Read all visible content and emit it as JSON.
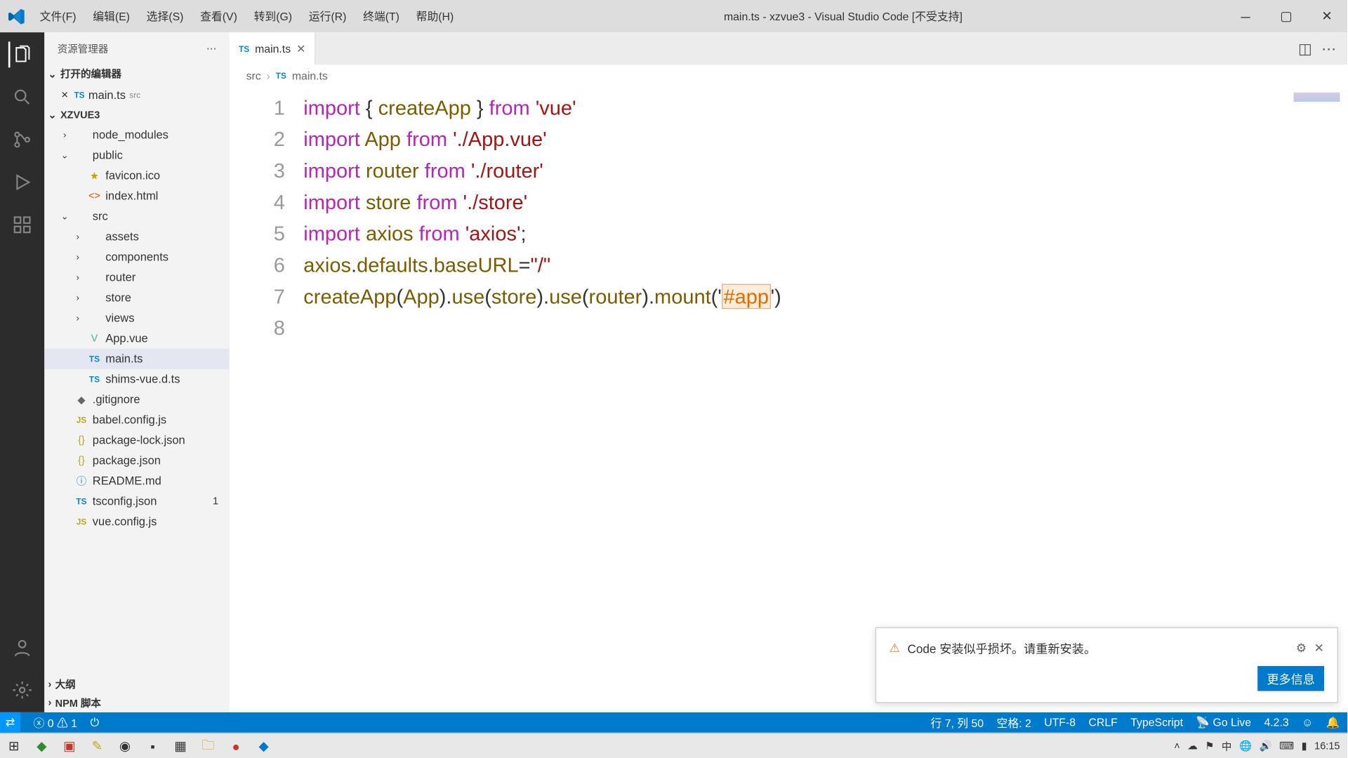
{
  "window": {
    "title": "main.ts - xzvue3 - Visual Studio Code [不受支持]"
  },
  "menu": [
    "文件(F)",
    "编辑(E)",
    "选择(S)",
    "查看(V)",
    "转到(G)",
    "运行(R)",
    "终端(T)",
    "帮助(H)"
  ],
  "sidebar": {
    "title": "资源管理器",
    "sections": {
      "openEditors": {
        "label": "打开的编辑器"
      },
      "project": {
        "label": "XZVUE3"
      },
      "outline": {
        "label": "大纲"
      },
      "npm": {
        "label": "NPM 脚本"
      }
    },
    "openEditorItem": {
      "file": "main.ts",
      "hint": "src"
    },
    "tree": [
      {
        "indent": 0,
        "twist": "›",
        "ico": "",
        "name": "node_modules"
      },
      {
        "indent": 0,
        "twist": "⌄",
        "ico": "",
        "name": "public"
      },
      {
        "indent": 1,
        "twist": "",
        "icoCls": "",
        "ico": "★",
        "name": "favicon.ico",
        "icoColor": "#c9a000"
      },
      {
        "indent": 1,
        "twist": "",
        "ico": "<>",
        "name": "index.html",
        "icoColor": "#d35400"
      },
      {
        "indent": 0,
        "twist": "⌄",
        "ico": "",
        "name": "src"
      },
      {
        "indent": 1,
        "twist": "›",
        "ico": "",
        "name": "assets"
      },
      {
        "indent": 1,
        "twist": "›",
        "ico": "",
        "name": "components"
      },
      {
        "indent": 1,
        "twist": "›",
        "ico": "",
        "name": "router"
      },
      {
        "indent": 1,
        "twist": "›",
        "ico": "",
        "name": "store"
      },
      {
        "indent": 1,
        "twist": "›",
        "ico": "",
        "name": "views"
      },
      {
        "indent": 1,
        "twist": "",
        "ico": "V",
        "name": "App.vue",
        "icoColor": "#41b883"
      },
      {
        "indent": 1,
        "twist": "",
        "ico": "TS",
        "name": "main.ts",
        "icoColor": "#0288d1",
        "sel": true
      },
      {
        "indent": 1,
        "twist": "",
        "ico": "TS",
        "name": "shims-vue.d.ts",
        "icoColor": "#0288d1"
      },
      {
        "indent": 0,
        "twist": "",
        "ico": "◆",
        "name": ".gitignore",
        "icoColor": "#666"
      },
      {
        "indent": 0,
        "twist": "",
        "ico": "JS",
        "name": "babel.config.js",
        "icoColor": "#b9a61c"
      },
      {
        "indent": 0,
        "twist": "",
        "ico": "{}",
        "name": "package-lock.json",
        "icoColor": "#b9a61c"
      },
      {
        "indent": 0,
        "twist": "",
        "ico": "{}",
        "name": "package.json",
        "icoColor": "#b9a61c"
      },
      {
        "indent": 0,
        "twist": "",
        "ico": "ⓘ",
        "name": "README.md",
        "icoColor": "#2980b9"
      },
      {
        "indent": 0,
        "twist": "",
        "ico": "TS",
        "name": "tsconfig.json",
        "icoColor": "#0288d1",
        "count": "1"
      },
      {
        "indent": 0,
        "twist": "",
        "ico": "JS",
        "name": "vue.config.js",
        "icoColor": "#b9a61c"
      }
    ]
  },
  "tab": {
    "label": "main.ts",
    "icon": "TS"
  },
  "breadcrumb": {
    "a": "src",
    "b": "main.ts",
    "iconB": "TS"
  },
  "code": {
    "lines": [
      [
        {
          "c": "kw",
          "t": "import"
        },
        {
          "c": "punc",
          "t": " { "
        },
        {
          "c": "fn",
          "t": "createApp"
        },
        {
          "c": "punc",
          "t": " } "
        },
        {
          "c": "kw",
          "t": "from"
        },
        {
          "c": "punc",
          "t": " "
        },
        {
          "c": "str",
          "t": "'vue'"
        }
      ],
      [
        {
          "c": "kw",
          "t": "import"
        },
        {
          "c": "punc",
          "t": " "
        },
        {
          "c": "fn",
          "t": "App"
        },
        {
          "c": "punc",
          "t": " "
        },
        {
          "c": "kw",
          "t": "from"
        },
        {
          "c": "punc",
          "t": " "
        },
        {
          "c": "str",
          "t": "'./App.vue'"
        }
      ],
      [
        {
          "c": "kw",
          "t": "import"
        },
        {
          "c": "punc",
          "t": " "
        },
        {
          "c": "fn",
          "t": "router"
        },
        {
          "c": "punc",
          "t": " "
        },
        {
          "c": "kw",
          "t": "from"
        },
        {
          "c": "punc",
          "t": " "
        },
        {
          "c": "str",
          "t": "'./router'"
        }
      ],
      [
        {
          "c": "kw",
          "t": "import"
        },
        {
          "c": "punc",
          "t": " "
        },
        {
          "c": "fn",
          "t": "store"
        },
        {
          "c": "punc",
          "t": " "
        },
        {
          "c": "kw",
          "t": "from"
        },
        {
          "c": "punc",
          "t": " "
        },
        {
          "c": "str",
          "t": "'./store'"
        }
      ],
      [
        {
          "c": "kw",
          "t": "import"
        },
        {
          "c": "punc",
          "t": " "
        },
        {
          "c": "fn",
          "t": "axios"
        },
        {
          "c": "punc",
          "t": " "
        },
        {
          "c": "kw",
          "t": "from"
        },
        {
          "c": "punc",
          "t": " "
        },
        {
          "c": "str",
          "t": "'axios'"
        },
        {
          "c": "punc",
          "t": ";"
        }
      ],
      [
        {
          "c": "fn",
          "t": "axios"
        },
        {
          "c": "punc",
          "t": "."
        },
        {
          "c": "fn",
          "t": "defaults"
        },
        {
          "c": "punc",
          "t": "."
        },
        {
          "c": "fn",
          "t": "baseURL"
        },
        {
          "c": "punc",
          "t": "="
        },
        {
          "c": "str",
          "t": "\"/\""
        }
      ],
      [
        {
          "c": "fn",
          "t": "createApp"
        },
        {
          "c": "punc",
          "t": "("
        },
        {
          "c": "fn",
          "t": "App"
        },
        {
          "c": "punc",
          "t": ")."
        },
        {
          "c": "fn",
          "t": "use"
        },
        {
          "c": "punc",
          "t": "("
        },
        {
          "c": "fn",
          "t": "store"
        },
        {
          "c": "punc",
          "t": ")."
        },
        {
          "c": "fn",
          "t": "use"
        },
        {
          "c": "punc",
          "t": "("
        },
        {
          "c": "fn",
          "t": "router"
        },
        {
          "c": "punc",
          "t": ")."
        },
        {
          "c": "fn",
          "t": "mount"
        },
        {
          "c": "punc",
          "t": "('"
        },
        {
          "c": "hl",
          "t": "#app"
        },
        {
          "c": "punc",
          "t": "')"
        }
      ],
      []
    ]
  },
  "notification": {
    "message": "Code 安装似乎损坏。请重新安装。",
    "button": "更多信息"
  },
  "status": {
    "errors": "0",
    "warnings": "1",
    "pos": "行 7, 列 50",
    "spaces": "空格: 2",
    "encoding": "UTF-8",
    "eol": "CRLF",
    "lang": "TypeScript",
    "golive": "Go Live",
    "ver": "4.2.3"
  },
  "taskbar": {
    "time": "16:15"
  }
}
